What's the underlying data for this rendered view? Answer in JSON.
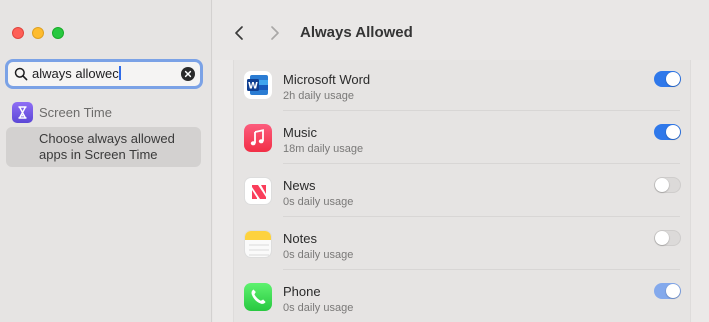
{
  "sidebar": {
    "search": {
      "value": "always allowed",
      "typed_visible": "always allowec"
    },
    "result_section": {
      "label": "Screen Time"
    },
    "result_item": {
      "line1": "Choose always allowed",
      "line2": "apps in Screen Time"
    }
  },
  "toolbar": {
    "title": "Always Allowed"
  },
  "apps": [
    {
      "name": "Microsoft Word",
      "usage": "2h daily usage",
      "toggle": "on",
      "icon": "word-icon"
    },
    {
      "name": "Music",
      "usage": "18m daily usage",
      "toggle": "on",
      "icon": "music-icon"
    },
    {
      "name": "News",
      "usage": "0s daily usage",
      "toggle": "off",
      "icon": "news-icon"
    },
    {
      "name": "Notes",
      "usage": "0s daily usage",
      "toggle": "off",
      "icon": "notes-icon"
    },
    {
      "name": "Phone",
      "usage": "0s daily usage",
      "toggle": "on-disabled",
      "icon": "phone-icon"
    }
  ],
  "colors": {
    "accent": "#2f78ea",
    "search_focus": "#7ba2e6"
  }
}
